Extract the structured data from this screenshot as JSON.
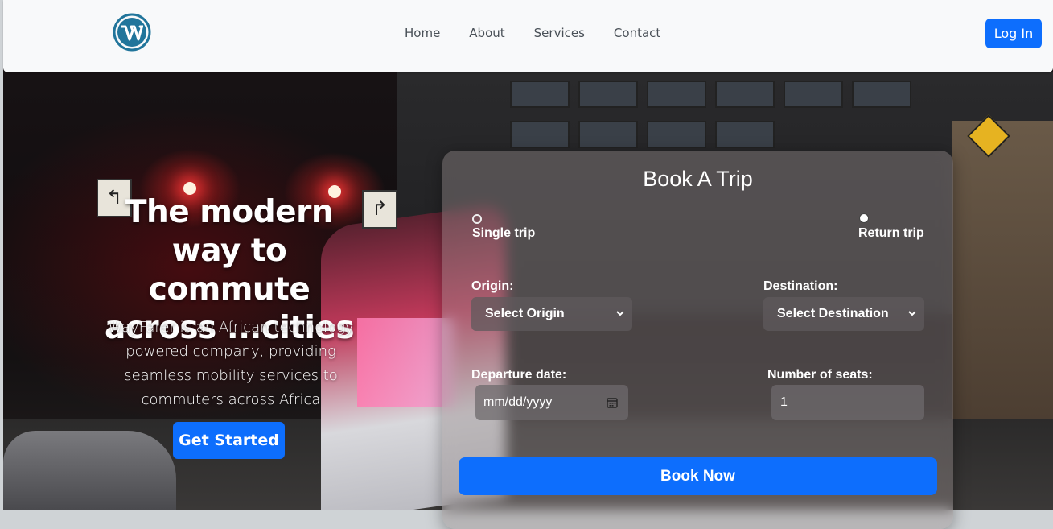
{
  "nav": {
    "logo_icon": "wordpress-logo-icon",
    "links": [
      "Home",
      "About",
      "Services",
      "Contact"
    ],
    "login_label": "Log In"
  },
  "hero": {
    "title": "The modern way to commute across ...cities",
    "description": "WayFarer is an African technology powered company, providing seamless mobility services to commuters across Africa",
    "cta_label": "Get Started"
  },
  "booking": {
    "title": "Book A Trip",
    "trip_types": {
      "single": "Single trip",
      "return": "Return trip"
    },
    "origin_label": "Origin:",
    "origin_value": "Select Origin",
    "destination_label": "Destination:",
    "destination_value": "Select Destination",
    "date_label": "Departure date:",
    "date_placeholder": "mm/dd/yyyy",
    "seats_label": "Number of seats:",
    "seats_value": "1",
    "submit_label": "Book Now"
  },
  "colors": {
    "primary": "#0d6efd",
    "navbar_bg": "#f8f9fa"
  }
}
